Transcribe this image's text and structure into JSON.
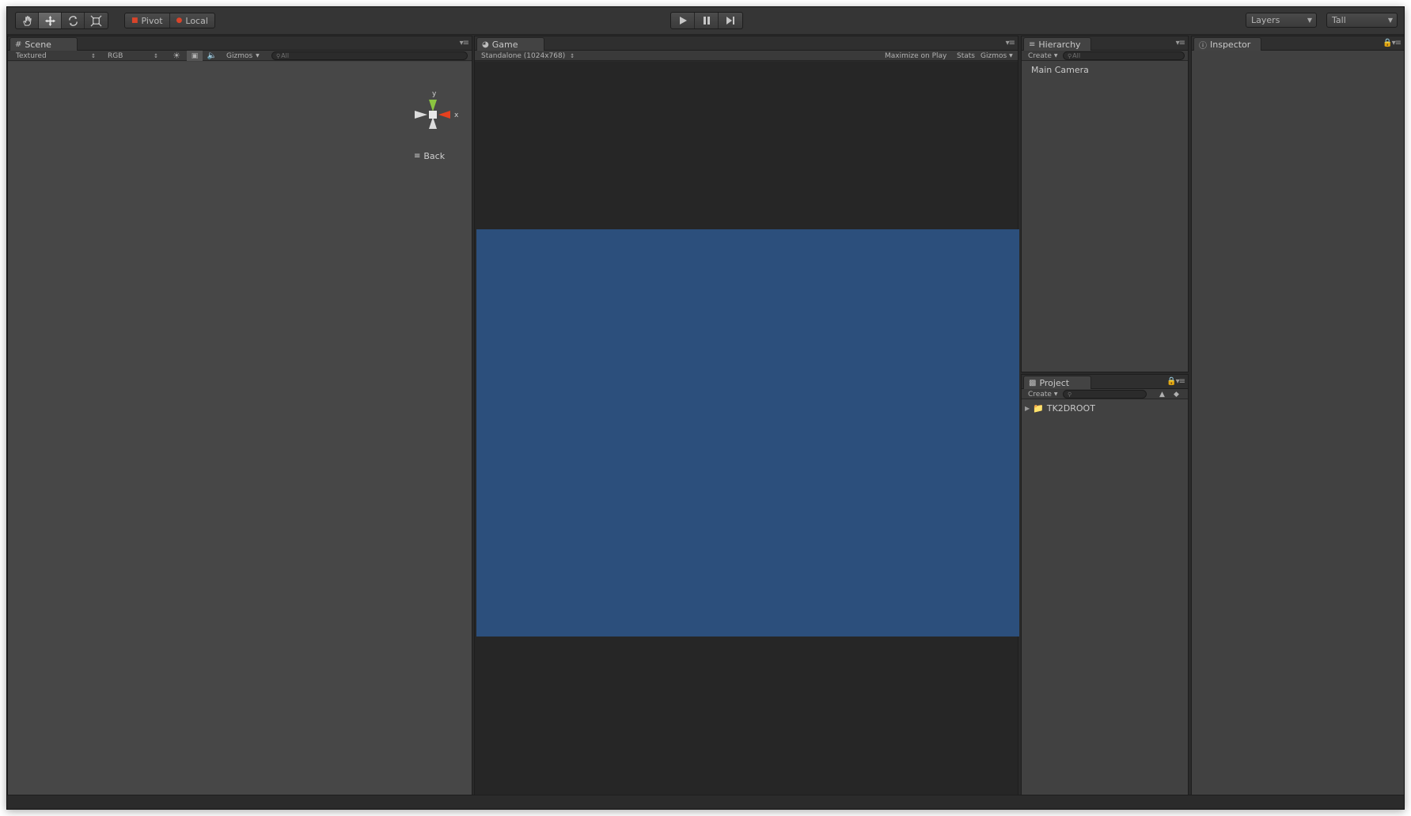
{
  "toolbar": {
    "tools": [
      {
        "name": "hand-tool",
        "icon": "hand-icon"
      },
      {
        "name": "move-tool",
        "icon": "move-icon",
        "active": true
      },
      {
        "name": "rotate-tool",
        "icon": "rotate-icon"
      },
      {
        "name": "scale-tool",
        "icon": "scale-icon"
      }
    ],
    "pivot_label": "Pivot",
    "local_label": "Local",
    "layers_label": "Layers",
    "layout_label": "Tall"
  },
  "scene": {
    "tab_label": "Scene",
    "render_mode": "Textured",
    "channel": "RGB",
    "gizmos_label": "Gizmos",
    "search_placeholder": "All",
    "gizmo": {
      "y_label": "y",
      "x_label": "x",
      "view_label": "Back"
    }
  },
  "game": {
    "tab_label": "Game",
    "resolution": "Standalone (1024x768)",
    "maximize_label": "Maximize on Play",
    "stats_label": "Stats",
    "gizmos_label": "Gizmos",
    "camera_background": "#2c4f7c"
  },
  "hierarchy": {
    "tab_label": "Hierarchy",
    "create_label": "Create",
    "search_placeholder": "All",
    "items": [
      "Main Camera"
    ]
  },
  "project": {
    "tab_label": "Project",
    "create_label": "Create",
    "items": [
      "TK2DROOT"
    ]
  },
  "inspector": {
    "tab_label": "Inspector"
  },
  "colors": {
    "gizmo_y": "#8bc540",
    "gizmo_x": "#e5401f",
    "panel_bg": "#414141"
  }
}
